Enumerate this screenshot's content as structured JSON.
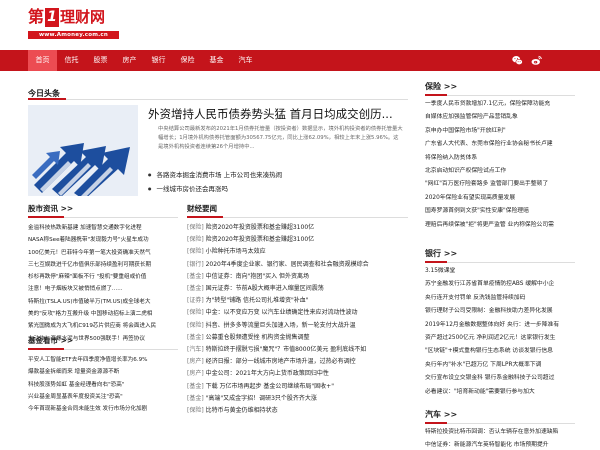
{
  "logo": {
    "di": "第",
    "one": "1",
    "text": "理财网",
    "url": "www.Amoney.com.cn"
  },
  "nav": {
    "items": [
      "首页",
      "信托",
      "股票",
      "房产",
      "银行",
      "保险",
      "基金",
      "汽车"
    ]
  },
  "today": {
    "title": "今日头条",
    "headline": "外资增持人民币债券势头猛 首月日均成交创历...",
    "summary": "中央结算公司最新发布的2021年1月债券托管量（按投资者）数据显示，境外机构投资者的债券托管量大幅增长；1月境外机构债券托管面额为30567.75亿元，同比上涨62.09%，相较上年末上涨5.96%。这是境外机构投资者连续第26个月增持中...",
    "bullets": [
      "各路资本掘金消费市场 上市公司也来凑热闹",
      "一线城市房价还会再涨吗"
    ]
  },
  "stock": {
    "title": "股市资讯 >>",
    "lines": [
      "金溢科技热跌新基建 加速智慧交通数字化进程",
      "NASA称See着陆器携带\"发现毅力号\"火星车成功",
      "100亿美元！巴菲特今年第一笔大投资确准天然气",
      "三七互娱跌进千亿市值俱乐部持续盈利可期获长期",
      "杉杉再跌停\"麻辣\"面板不行  \"投机\"要重组或价值",
      "注意！电子烟板块又被悄悄点燃了......",
      "特斯拉(TSLA.US)市值破半万(TM.US)成全球老大",
      "美的\"反攻\"格力互搬升级  中国移动招标上演二虎相",
      "紫光国微成为大飞机C919芯片供应商 将会面进入民",
      "大动作！海螺水泥与世界500强联手！再签协议"
    ]
  },
  "fund": {
    "title": "基金看市 >>",
    "lines": [
      "平安人工智能ETF去年四季度净值增长率为6.9%",
      "爆款基金拆细而来 增量资金源源不断",
      "科技股涨势如虹 基金经理看向右\"恐高\"",
      "兴业基金周显基表年度投资关注\"恐高\"",
      "今年首现新基金合同未能生效 发行市场分化加剧"
    ]
  },
  "finance": {
    "title": "财经要闻",
    "items": [
      {
        "tag": "[保险]",
        "text": " 险资2020年投资股票和基金赚超3100亿"
      },
      {
        "tag": "[保险]",
        "text": " 险资2020年投资股票和基金赚超3100亿"
      },
      {
        "tag": "[保险]",
        "text": " 小险种托市场马太效应"
      },
      {
        "tag": "[银行]",
        "text": " 2020年4季度企业家、银行家、居民调查和社会融资规模综合"
      },
      {
        "tag": "[基金]",
        "text": " 中信证券：南向\"抱团\"买入  但外资离场"
      },
      {
        "tag": "[基金]",
        "text": " 国元证券：节前A股大概率进入缩量区间震荡"
      },
      {
        "tag": "[证券]",
        "text": " 为\"转型\"铺路 信托公司扎堆增资\"补血\""
      },
      {
        "tag": "[保险]",
        "text": " 中金：以不变应万变  以汽车业绩确定性来应对流动性波动"
      },
      {
        "tag": "[保险]",
        "text": " 抖音、拼多多等流量巨头加速入场，新一轮支付大战升温"
      },
      {
        "tag": "[基金]",
        "text": " 公募重仓股频遭受挫  机构资金抛售调整"
      },
      {
        "tag": "[汽车]",
        "text": " 特斯拉终于摆脱亏损\"魔咒\"？市值8000亿美元 盈利底线不如"
      },
      {
        "tag": "[房产]",
        "text": " 经济日报：部分一线城市房地产市场升温，过热必有调控"
      },
      {
        "tag": "[房产]",
        "text": " 中金公司：2021年大方向上货币政策回归中性"
      },
      {
        "tag": "[基金]",
        "text": " 下载 万亿市场再起步 基金公司继续布局\"固收+\""
      },
      {
        "tag": "[基金]",
        "text": " \"高端\"又成金字招！调研3只个股齐齐大涨"
      },
      {
        "tag": "[保险]",
        "text": " 比特币与黄金仍维相持状态"
      }
    ]
  },
  "insurance": {
    "title": "保险 >>",
    "items": [
      "一季度人民币贷款增加7.1亿元，保险保障功能充",
      "自媒体应加强监管保险产品营销乱象",
      "京申办中国保险市场\"开放红利\"",
      "广东省人大代表、东莞市保险行业协会秘书长卢建",
      "将保险纳入防贫体系",
      "北京启动知识产权保险试点工作",
      "\"网红\"百万医疗险套路多 监管部门要出手整顿了",
      "2020年保险业有望实现高质量发展",
      "国寿罗源首例到文获\"实性安康\"保险理赔",
      "理赔后再续保被\"拒\"将更严监管 业内称保险公司需"
    ]
  },
  "bank": {
    "title": "银行 >>",
    "items": [
      "3.15微课堂",
      "苏宁金融发行江苏省首单疫情防控ABS 缓解中小企",
      "央行连开支付罚单  反洗钱监管持续加码",
      "银行理财子公司受限制：金融科技助力差异化发展",
      "2019年12月金融数据整体向好  央行：进一步降准有",
      "资产超过2500亿元 净利润近2亿元！这家银行发生",
      "\"区块链\"+模式重构银行生态系统 访谈发银行信息",
      "央行年内\"补水\"已超万亿 下周LPR大概率下调",
      "交行宣布设立交银金科 银行系金融科技子公司超过",
      "必看建议：\"培育新动能\"需要银行参与加大"
    ]
  },
  "auto": {
    "title": "汽车 >>",
    "items": [
      "特斯拉投资比特币回调：否认车辆存在意外加速缺陷",
      "中信证券：新能源汽车英特智能化 市场预期提升"
    ]
  },
  "colors": {
    "brand_red": "#c4141b",
    "nav_active": "#ec4c52"
  }
}
